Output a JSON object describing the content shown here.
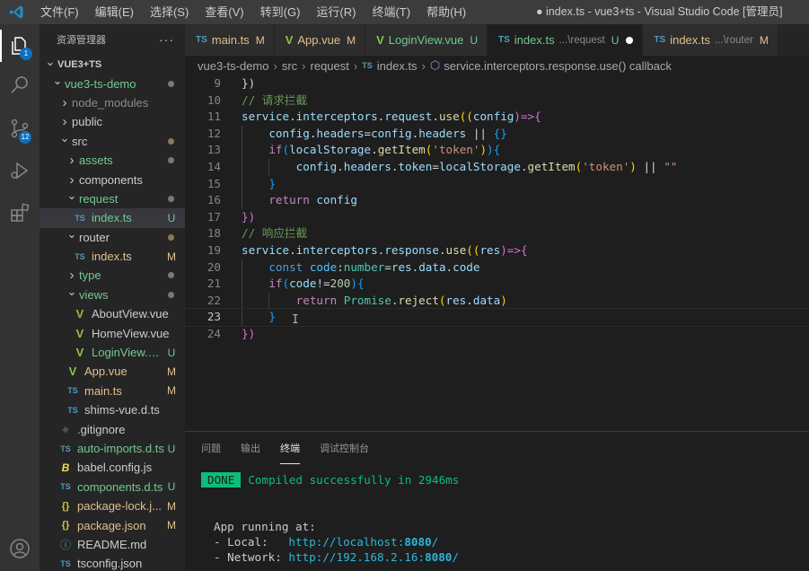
{
  "menu": [
    "文件(F)",
    "编辑(E)",
    "选择(S)",
    "查看(V)",
    "转到(G)",
    "运行(R)",
    "终端(T)",
    "帮助(H)"
  ],
  "window_title": "● index.ts - vue3+ts - Visual Studio Code [管理员]",
  "activity_bar": {
    "explorer_badge": "1",
    "scm_badge": "12"
  },
  "sidebar": {
    "title": "资源管理器",
    "more": "···",
    "items": [
      {
        "label": "VUE3+TS",
        "depth": 0,
        "type": "root",
        "chevron": "down"
      },
      {
        "label": "vue3-ts-demo",
        "depth": 1,
        "type": "folder",
        "chevron": "down",
        "color": "#73c991",
        "dot": "#6e7f73"
      },
      {
        "label": "node_modules",
        "depth": 2,
        "type": "folder",
        "chevron": "right",
        "color": "#8c8c8c"
      },
      {
        "label": "public",
        "depth": 2,
        "type": "folder",
        "chevron": "right",
        "color": "#cccccc"
      },
      {
        "label": "src",
        "depth": 2,
        "type": "folder",
        "chevron": "down",
        "color": "#cccccc",
        "dot": "#8a7a5a"
      },
      {
        "label": "assets",
        "depth": 3,
        "type": "folder",
        "chevron": "right",
        "color": "#73c991",
        "dot": "#6e7f73"
      },
      {
        "label": "components",
        "depth": 3,
        "type": "folder",
        "chevron": "right",
        "color": "#cccccc"
      },
      {
        "label": "request",
        "depth": 3,
        "type": "folder",
        "chevron": "down",
        "color": "#73c991",
        "dot": "#6e7f73"
      },
      {
        "label": "index.ts",
        "depth": 4,
        "type": "ts",
        "color": "#73c991",
        "status": "U",
        "selected": true
      },
      {
        "label": "router",
        "depth": 3,
        "type": "folder",
        "chevron": "down",
        "color": "#cccccc",
        "dot": "#8a7a5a"
      },
      {
        "label": "index.ts",
        "depth": 4,
        "type": "ts",
        "color": "#e2c08d",
        "status": "M"
      },
      {
        "label": "type",
        "depth": 3,
        "type": "folder",
        "chevron": "right",
        "color": "#73c991",
        "dot": "#6e7f73"
      },
      {
        "label": "views",
        "depth": 3,
        "type": "folder",
        "chevron": "down",
        "color": "#73c991",
        "dot": "#6e7f73"
      },
      {
        "label": "AboutView.vue",
        "depth": 4,
        "type": "vue",
        "color": "#cccccc"
      },
      {
        "label": "HomeView.vue",
        "depth": 4,
        "type": "vue",
        "color": "#cccccc"
      },
      {
        "label": "LoginView.vue",
        "depth": 4,
        "type": "vue",
        "color": "#73c991",
        "status": "U"
      },
      {
        "label": "App.vue",
        "depth": 3,
        "type": "vue",
        "color": "#e2c08d",
        "status": "M"
      },
      {
        "label": "main.ts",
        "depth": 3,
        "type": "ts",
        "color": "#e2c08d",
        "status": "M"
      },
      {
        "label": "shims-vue.d.ts",
        "depth": 3,
        "type": "ts",
        "color": "#cccccc"
      },
      {
        "label": ".gitignore",
        "depth": 2,
        "type": "git",
        "color": "#cccccc"
      },
      {
        "label": "auto-imports.d.ts",
        "depth": 2,
        "type": "ts",
        "color": "#73c991",
        "status": "U"
      },
      {
        "label": "babel.config.js",
        "depth": 2,
        "type": "babel",
        "color": "#cccccc"
      },
      {
        "label": "components.d.ts",
        "depth": 2,
        "type": "ts",
        "color": "#73c991",
        "status": "U"
      },
      {
        "label": "package-lock.j...",
        "depth": 2,
        "type": "json",
        "color": "#e2c08d",
        "status": "M"
      },
      {
        "label": "package.json",
        "depth": 2,
        "type": "json",
        "color": "#e2c08d",
        "status": "M"
      },
      {
        "label": "README.md",
        "depth": 2,
        "type": "info",
        "color": "#cccccc"
      },
      {
        "label": "tsconfig.json",
        "depth": 2,
        "type": "ts",
        "color": "#cccccc"
      }
    ]
  },
  "tabs": [
    {
      "icon": "TS",
      "icon_color": "#519aba",
      "label": "main.ts",
      "status": "M",
      "color": "#e2c08d"
    },
    {
      "icon": "V",
      "icon_color": "#8dc149",
      "label": "App.vue",
      "status": "M",
      "color": "#e2c08d"
    },
    {
      "icon": "V",
      "icon_color": "#8dc149",
      "label": "LoginView.vue",
      "status": "U",
      "color": "#73c991"
    },
    {
      "icon": "TS",
      "icon_color": "#519aba",
      "label": "index.ts",
      "desc": "...\\request",
      "status": "U",
      "color": "#73c991",
      "active": true,
      "dirty": true
    },
    {
      "icon": "TS",
      "icon_color": "#519aba",
      "label": "index.ts",
      "desc": "...\\router",
      "status": "M",
      "color": "#e2c08d"
    }
  ],
  "breadcrumb": [
    "vue3-ts-demo",
    "src",
    "request",
    "index.ts",
    "service.interceptors.response.use() callback"
  ],
  "editor": {
    "current_line": 23,
    "lines": [
      {
        "n": 9,
        "tokens": [
          [
            "})",
            "#d4d4d4"
          ]
        ]
      },
      {
        "n": 10,
        "tokens": [
          [
            "// 请求拦截",
            "#6a9955"
          ]
        ]
      },
      {
        "n": 11,
        "tokens": [
          [
            "service",
            "#9cdcfe"
          ],
          [
            ".",
            "#d4d4d4"
          ],
          [
            "interceptors",
            "#9cdcfe"
          ],
          [
            ".",
            "#d4d4d4"
          ],
          [
            "request",
            "#9cdcfe"
          ],
          [
            ".",
            "#d4d4d4"
          ],
          [
            "use",
            "#dcdcaa"
          ],
          [
            "((",
            "#ffd700"
          ],
          [
            "config",
            "#9cdcfe"
          ],
          [
            ")=>",
            "#da70d6"
          ],
          [
            "{",
            "#da70d6"
          ]
        ]
      },
      {
        "n": 12,
        "tokens": [
          [
            "    config",
            "#9cdcfe"
          ],
          [
            ".",
            "#d4d4d4"
          ],
          [
            "headers",
            "#9cdcfe"
          ],
          [
            "=",
            "#d4d4d4"
          ],
          [
            "config",
            "#9cdcfe"
          ],
          [
            ".",
            "#d4d4d4"
          ],
          [
            "headers",
            "#9cdcfe"
          ],
          [
            " || ",
            "#d4d4d4"
          ],
          [
            "{}",
            "#179fff"
          ]
        ]
      },
      {
        "n": 13,
        "tokens": [
          [
            "    if",
            "#c586c0"
          ],
          [
            "(",
            "#179fff"
          ],
          [
            "localStorage",
            "#9cdcfe"
          ],
          [
            ".",
            "#d4d4d4"
          ],
          [
            "getItem",
            "#dcdcaa"
          ],
          [
            "(",
            "#ffd700"
          ],
          [
            "'token'",
            "#ce9178"
          ],
          [
            ")",
            "#ffd700"
          ],
          [
            ")",
            "#179fff"
          ],
          [
            "{",
            "#179fff"
          ]
        ]
      },
      {
        "n": 14,
        "tokens": [
          [
            "        config",
            "#9cdcfe"
          ],
          [
            ".",
            "#d4d4d4"
          ],
          [
            "headers",
            "#9cdcfe"
          ],
          [
            ".",
            "#d4d4d4"
          ],
          [
            "token",
            "#9cdcfe"
          ],
          [
            "=",
            "#d4d4d4"
          ],
          [
            "localStorage",
            "#9cdcfe"
          ],
          [
            ".",
            "#d4d4d4"
          ],
          [
            "getItem",
            "#dcdcaa"
          ],
          [
            "(",
            "#ffd700"
          ],
          [
            "'token'",
            "#ce9178"
          ],
          [
            ")",
            "#ffd700"
          ],
          [
            " || ",
            "#d4d4d4"
          ],
          [
            "\"\"",
            "#ce9178"
          ]
        ]
      },
      {
        "n": 15,
        "tokens": [
          [
            "    }",
            "#179fff"
          ]
        ]
      },
      {
        "n": 16,
        "tokens": [
          [
            "    return",
            "#c586c0"
          ],
          [
            " config",
            "#9cdcfe"
          ]
        ]
      },
      {
        "n": 17,
        "tokens": [
          [
            "})",
            "#da70d6"
          ]
        ]
      },
      {
        "n": 18,
        "tokens": [
          [
            "// 响应拦截",
            "#6a9955"
          ]
        ]
      },
      {
        "n": 19,
        "tokens": [
          [
            "service",
            "#9cdcfe"
          ],
          [
            ".",
            "#d4d4d4"
          ],
          [
            "interceptors",
            "#9cdcfe"
          ],
          [
            ".",
            "#d4d4d4"
          ],
          [
            "response",
            "#9cdcfe"
          ],
          [
            ".",
            "#d4d4d4"
          ],
          [
            "use",
            "#dcdcaa"
          ],
          [
            "((",
            "#ffd700"
          ],
          [
            "res",
            "#9cdcfe"
          ],
          [
            ")=>",
            "#da70d6"
          ],
          [
            "{",
            "#da70d6"
          ]
        ]
      },
      {
        "n": 20,
        "tokens": [
          [
            "    const",
            "#569cd6"
          ],
          [
            " code",
            "#4fc1ff"
          ],
          [
            ":",
            "#d4d4d4"
          ],
          [
            "number",
            "#4ec9b0"
          ],
          [
            "=",
            "#d4d4d4"
          ],
          [
            "res",
            "#9cdcfe"
          ],
          [
            ".",
            "#d4d4d4"
          ],
          [
            "data",
            "#9cdcfe"
          ],
          [
            ".",
            "#d4d4d4"
          ],
          [
            "code",
            "#9cdcfe"
          ]
        ]
      },
      {
        "n": 21,
        "tokens": [
          [
            "    if",
            "#c586c0"
          ],
          [
            "(",
            "#179fff"
          ],
          [
            "code",
            "#9cdcfe"
          ],
          [
            "!=",
            "#d4d4d4"
          ],
          [
            "200",
            "#b5cea8"
          ],
          [
            ")",
            "#179fff"
          ],
          [
            "{",
            "#179fff"
          ]
        ]
      },
      {
        "n": 22,
        "tokens": [
          [
            "        return",
            "#c586c0"
          ],
          [
            " Promise",
            "#4ec9b0"
          ],
          [
            ".",
            "#d4d4d4"
          ],
          [
            "reject",
            "#dcdcaa"
          ],
          [
            "(",
            "#ffd700"
          ],
          [
            "res",
            "#9cdcfe"
          ],
          [
            ".",
            "#d4d4d4"
          ],
          [
            "data",
            "#9cdcfe"
          ],
          [
            ")",
            "#ffd700"
          ]
        ]
      },
      {
        "n": 23,
        "tokens": [
          [
            "    }",
            "#179fff"
          ]
        ]
      },
      {
        "n": 24,
        "tokens": [
          [
            "})",
            "#da70d6"
          ]
        ]
      }
    ]
  },
  "panel": {
    "tabs": [
      {
        "label": "问题",
        "active": false
      },
      {
        "label": "输出",
        "active": false
      },
      {
        "label": "终端",
        "active": true
      },
      {
        "label": "调试控制台",
        "active": false
      }
    ],
    "terminal": {
      "done_badge": "DONE",
      "compiled": "Compiled successfully in 2946ms",
      "running": "App running at:",
      "local_label": "- Local:   ",
      "local_url": "http://localhost:",
      "local_port": "8080",
      "network_label": "- Network: ",
      "network_url": "http://192.168.2.16:",
      "network_port": "8080",
      "trailing_slash": "/"
    }
  }
}
